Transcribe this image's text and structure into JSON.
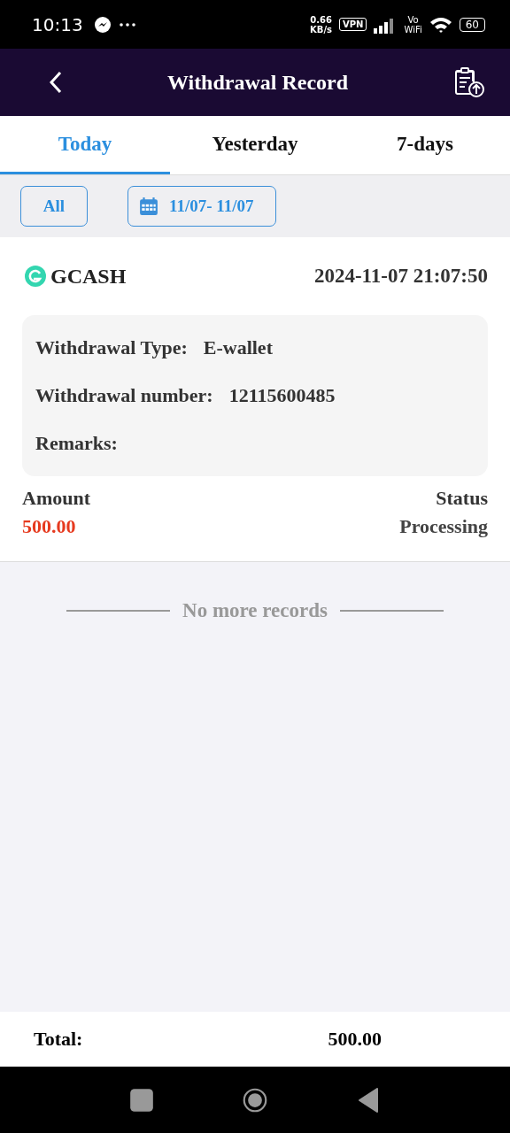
{
  "status_bar": {
    "time": "10:13",
    "speed": "0.66",
    "speed_unit": "KB/s",
    "vpn": "VPN",
    "vowifi_top": "Vo",
    "vowifi_bottom": "WiFi",
    "battery": "60"
  },
  "header": {
    "title": "Withdrawal Record"
  },
  "tabs": [
    {
      "label": "Today",
      "selected": true
    },
    {
      "label": "Yesterday",
      "selected": false
    },
    {
      "label": "7-days",
      "selected": false
    }
  ],
  "filters": {
    "all": "All",
    "date_range": "11/07- 11/07"
  },
  "records": [
    {
      "method": "GCASH",
      "time": "2024-11-07 21:07:50",
      "details": [
        {
          "label": "Withdrawal Type:",
          "value": "E-wallet"
        },
        {
          "label": "Withdrawal number:",
          "value": "12115600485"
        },
        {
          "label": "Remarks:"
        }
      ],
      "amount_label": "Amount",
      "amount": "500.00",
      "status_label": "Status",
      "status": "Processing"
    }
  ],
  "end_note": "No more records",
  "footer": {
    "label": "Total:",
    "value": "500.00"
  }
}
